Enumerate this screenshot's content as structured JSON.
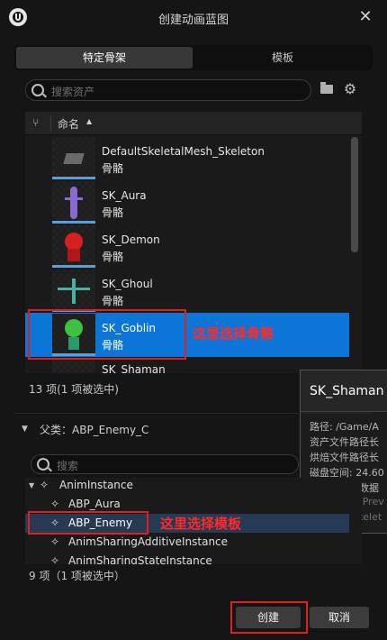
{
  "window": {
    "title": "创建动画蓝图"
  },
  "tabs": [
    {
      "label": "特定骨架"
    },
    {
      "label": "模板"
    }
  ],
  "search": {
    "placeholder": "搜索资产"
  },
  "list": {
    "column_name": "命名",
    "rows": [
      {
        "name": "DefaultSkeletalMesh_Skeleton",
        "type": "骨骼"
      },
      {
        "name": "SK_Aura",
        "type": "骨骼"
      },
      {
        "name": "SK_Demon",
        "type": "骨骼"
      },
      {
        "name": "SK_Ghoul",
        "type": "骨骼"
      },
      {
        "name": "SK_Goblin",
        "type": "骨骼"
      },
      {
        "name": "SK_Shaman",
        "type": ""
      }
    ],
    "count": "13 项(1 项被选中)"
  },
  "tooltip": {
    "title": "SK_Shaman",
    "lines": [
      "路径: /Game/A",
      "资产文件路径长",
      "烘焙文件路径长",
      "磁盘空间: 24.60",
      "拥有虚拟化数据",
      "Additional Prev",
      "Preview Skelet"
    ]
  },
  "parent": {
    "label": "父类：ABP_Enemy_C",
    "search_placeholder": "搜索",
    "tree": [
      {
        "label": "AnimInstance"
      },
      {
        "label": "ABP_Aura"
      },
      {
        "label": "ABP_Enemy"
      },
      {
        "label": "AnimSharingAdditiveInstance"
      },
      {
        "label": "AnimSharingStateInstance"
      }
    ],
    "count": "9 项（1 项被选中）"
  },
  "buttons": {
    "create": "创建",
    "cancel": "取消"
  },
  "annotations": {
    "skeleton": "这里选择骨骼",
    "template": "这里选择模板"
  },
  "colors": {
    "selection": "#0c76d8",
    "annotation": "#e02020"
  }
}
